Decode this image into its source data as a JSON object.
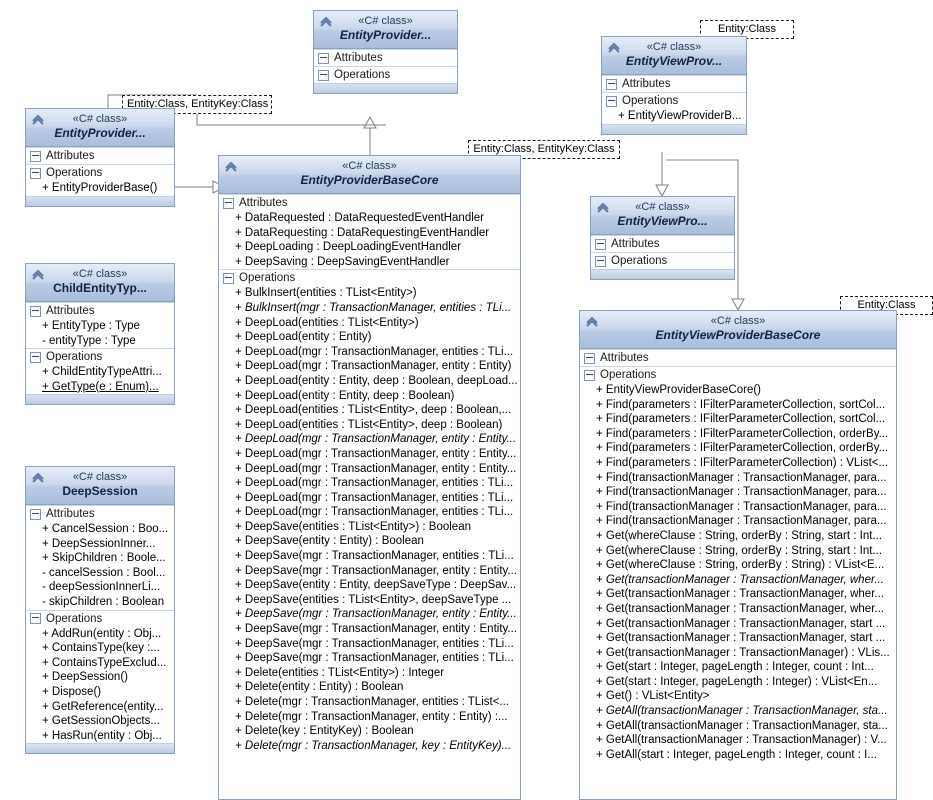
{
  "diagram": {
    "title": "UML Class Diagram",
    "stereotype": "«C# class»",
    "compartments": {
      "attributes": "Attributes",
      "operations": "Operations"
    },
    "icon": "double-chevron-icon"
  },
  "template_params": [
    {
      "id": "tp-entityprovider-base",
      "text": "Entity:Class, EntityKey:Class"
    },
    {
      "id": "tp-entityviewprov",
      "text": "Entity:Class"
    },
    {
      "id": "tp-entityproviderbasecore",
      "text": "Entity:Class, EntityKey:Class"
    },
    {
      "id": "tp-entityviewproviderbasecore",
      "text": "Entity:Class"
    }
  ],
  "classes": {
    "entity_provider_top": {
      "name": "EntityProvider...",
      "abstract": true,
      "attributes": [],
      "operations": []
    },
    "entity_provider_left": {
      "name": "EntityProvider...",
      "abstract": true,
      "attributes": [],
      "operations": [
        {
          "text": "+ EntityProviderBase()",
          "abstract": false,
          "static": false
        }
      ]
    },
    "child_entity_type": {
      "name": "ChildEntityTyp...",
      "abstract": false,
      "attributes": [
        {
          "text": "+ EntityType : Type",
          "abstract": false,
          "static": false
        },
        {
          "text": "- entityType : Type",
          "abstract": false,
          "static": false
        }
      ],
      "operations": [
        {
          "text": "+ ChildEntityTypeAttri...",
          "abstract": false,
          "static": false
        },
        {
          "text": "+ GetType(e : Enum)...",
          "abstract": false,
          "static": true
        }
      ]
    },
    "deep_session": {
      "name": "DeepSession",
      "abstract": false,
      "attributes": [
        {
          "text": "+ CancelSession : Boo...",
          "abstract": false,
          "static": false
        },
        {
          "text": "+ DeepSessionInner...",
          "abstract": false,
          "static": false
        },
        {
          "text": "+ SkipChildren : Boole...",
          "abstract": false,
          "static": false
        },
        {
          "text": "- cancelSession : Bool...",
          "abstract": false,
          "static": false
        },
        {
          "text": "- deepSessionInnerLi...",
          "abstract": false,
          "static": false
        },
        {
          "text": "- skipChildren : Boolean",
          "abstract": false,
          "static": false
        }
      ],
      "operations": [
        {
          "text": "+ AddRun(entity : Obj...",
          "abstract": false,
          "static": false
        },
        {
          "text": "+ ContainsType(key :...",
          "abstract": false,
          "static": false
        },
        {
          "text": "+ ContainsTypeExclud...",
          "abstract": false,
          "static": false
        },
        {
          "text": "+ DeepSession()",
          "abstract": false,
          "static": false
        },
        {
          "text": "+ Dispose()",
          "abstract": false,
          "static": false
        },
        {
          "text": "+ GetReference(entity...",
          "abstract": false,
          "static": false
        },
        {
          "text": "+ GetSessionObjects...",
          "abstract": false,
          "static": false
        },
        {
          "text": "+ HasRun(entity : Obj...",
          "abstract": false,
          "static": false
        }
      ]
    },
    "entity_provider_base_core": {
      "name": "EntityProviderBaseCore",
      "abstract": true,
      "attributes": [
        {
          "text": "+ DataRequested : DataRequestedEventHandler",
          "abstract": false,
          "static": false
        },
        {
          "text": "+ DataRequesting : DataRequestingEventHandler",
          "abstract": false,
          "static": false
        },
        {
          "text": "+ DeepLoading : DeepLoadingEventHandler",
          "abstract": false,
          "static": false
        },
        {
          "text": "+ DeepSaving : DeepSavingEventHandler",
          "abstract": false,
          "static": false
        }
      ],
      "operations": [
        {
          "text": "+ BulkInsert(entities : TList<Entity>)",
          "abstract": false,
          "static": false
        },
        {
          "text": "+ BulkInsert(mgr : TransactionManager, entities : TLi...",
          "abstract": true,
          "static": false
        },
        {
          "text": "+ DeepLoad(entities : TList<Entity>)",
          "abstract": false,
          "static": false
        },
        {
          "text": "+ DeepLoad(entity : Entity)",
          "abstract": false,
          "static": false
        },
        {
          "text": "+ DeepLoad(mgr : TransactionManager, entities : TLi...",
          "abstract": false,
          "static": false
        },
        {
          "text": "+ DeepLoad(mgr : TransactionManager, entity : Entity)",
          "abstract": false,
          "static": false
        },
        {
          "text": "+ DeepLoad(entity : Entity, deep : Boolean, deepLoad...",
          "abstract": false,
          "static": false
        },
        {
          "text": "+ DeepLoad(entity : Entity, deep : Boolean)",
          "abstract": false,
          "static": false
        },
        {
          "text": "+ DeepLoad(entities : TList<Entity>, deep : Boolean,...",
          "abstract": false,
          "static": false
        },
        {
          "text": "+ DeepLoad(entities : TList<Entity>, deep : Boolean)",
          "abstract": false,
          "static": false
        },
        {
          "text": "+ DeepLoad(mgr : TransactionManager, entity : Entity...",
          "abstract": true,
          "static": false
        },
        {
          "text": "+ DeepLoad(mgr : TransactionManager, entity : Entity...",
          "abstract": false,
          "static": false
        },
        {
          "text": "+ DeepLoad(mgr : TransactionManager, entity : Entity...",
          "abstract": false,
          "static": false
        },
        {
          "text": "+ DeepLoad(mgr : TransactionManager, entities : TLi...",
          "abstract": false,
          "static": false
        },
        {
          "text": "+ DeepLoad(mgr : TransactionManager, entities : TLi...",
          "abstract": false,
          "static": false
        },
        {
          "text": "+ DeepLoad(mgr : TransactionManager, entities : TLi...",
          "abstract": false,
          "static": false
        },
        {
          "text": "+ DeepSave(entities : TList<Entity>) : Boolean",
          "abstract": false,
          "static": false
        },
        {
          "text": "+ DeepSave(entity : Entity) : Boolean",
          "abstract": false,
          "static": false
        },
        {
          "text": "+ DeepSave(mgr : TransactionManager, entities : TLi...",
          "abstract": false,
          "static": false
        },
        {
          "text": "+ DeepSave(mgr : TransactionManager, entity : Entity...",
          "abstract": false,
          "static": false
        },
        {
          "text": "+ DeepSave(entity : Entity, deepSaveType : DeepSav...",
          "abstract": false,
          "static": false
        },
        {
          "text": "+ DeepSave(entities : TList<Entity>, deepSaveType ...",
          "abstract": false,
          "static": false
        },
        {
          "text": "+ DeepSave(mgr : TransactionManager, entity : Entity...",
          "abstract": true,
          "static": false
        },
        {
          "text": "+ DeepSave(mgr : TransactionManager, entity : Entity...",
          "abstract": false,
          "static": false
        },
        {
          "text": "+ DeepSave(mgr : TransactionManager, entities : TLi...",
          "abstract": false,
          "static": false
        },
        {
          "text": "+ DeepSave(mgr : TransactionManager, entities : TLi...",
          "abstract": false,
          "static": false
        },
        {
          "text": "+ Delete(entities : TList<Entity>) : Integer",
          "abstract": false,
          "static": false
        },
        {
          "text": "+ Delete(entity : Entity) : Boolean",
          "abstract": false,
          "static": false
        },
        {
          "text": "+ Delete(mgr : TransactionManager, entities : TList<...",
          "abstract": false,
          "static": false
        },
        {
          "text": "+ Delete(mgr : TransactionManager, entity : Entity) :...",
          "abstract": false,
          "static": false
        },
        {
          "text": "+ Delete(key : EntityKey) : Boolean",
          "abstract": false,
          "static": false
        },
        {
          "text": "+ Delete(mgr : TransactionManager, key : EntityKey)...",
          "abstract": true,
          "static": false
        }
      ]
    },
    "entity_view_prov_top": {
      "name": "EntityViewProv...",
      "abstract": true,
      "attributes": [],
      "operations": [
        {
          "text": "+ EntityViewProviderB...",
          "abstract": false,
          "static": false
        }
      ]
    },
    "entity_view_pro_mid": {
      "name": "EntityViewPro...",
      "abstract": true,
      "attributes": [],
      "operations": []
    },
    "entity_view_provider_base_core": {
      "name": "EntityViewProviderBaseCore",
      "abstract": true,
      "attributes": [],
      "operations": [
        {
          "text": "+ EntityViewProviderBaseCore()",
          "abstract": false,
          "static": false
        },
        {
          "text": "+ Find(parameters : IFilterParameterCollection, sortCol...",
          "abstract": false,
          "static": false
        },
        {
          "text": "+ Find(parameters : IFilterParameterCollection, sortCol...",
          "abstract": false,
          "static": false
        },
        {
          "text": "+ Find(parameters : IFilterParameterCollection, orderBy...",
          "abstract": false,
          "static": false
        },
        {
          "text": "+ Find(parameters : IFilterParameterCollection, orderBy...",
          "abstract": false,
          "static": false
        },
        {
          "text": "+ Find(parameters : IFilterParameterCollection) : VList<...",
          "abstract": false,
          "static": false
        },
        {
          "text": "+ Find(transactionManager : TransactionManager, para...",
          "abstract": false,
          "static": false
        },
        {
          "text": "+ Find(transactionManager : TransactionManager, para...",
          "abstract": false,
          "static": false
        },
        {
          "text": "+ Find(transactionManager : TransactionManager, para...",
          "abstract": false,
          "static": false
        },
        {
          "text": "+ Find(transactionManager : TransactionManager, para...",
          "abstract": false,
          "static": false
        },
        {
          "text": "+ Get(whereClause : String, orderBy : String, start : Int...",
          "abstract": false,
          "static": false
        },
        {
          "text": "+ Get(whereClause : String, orderBy : String, start : Int...",
          "abstract": false,
          "static": false
        },
        {
          "text": "+ Get(whereClause : String, orderBy : String) : VList<E...",
          "abstract": false,
          "static": false
        },
        {
          "text": "+ Get(transactionManager : TransactionManager, wher...",
          "abstract": true,
          "static": false
        },
        {
          "text": "+ Get(transactionManager : TransactionManager, wher...",
          "abstract": false,
          "static": false
        },
        {
          "text": "+ Get(transactionManager : TransactionManager, wher...",
          "abstract": false,
          "static": false
        },
        {
          "text": "+ Get(transactionManager : TransactionManager, start ...",
          "abstract": false,
          "static": false
        },
        {
          "text": "+ Get(transactionManager : TransactionManager, start ...",
          "abstract": false,
          "static": false
        },
        {
          "text": "+ Get(transactionManager : TransactionManager) : VLis...",
          "abstract": false,
          "static": false
        },
        {
          "text": "+ Get(start : Integer, pageLength : Integer, count : Int...",
          "abstract": false,
          "static": false
        },
        {
          "text": "+ Get(start : Integer, pageLength : Integer) : VList<En...",
          "abstract": false,
          "static": false
        },
        {
          "text": "+ Get() : VList<Entity>",
          "abstract": false,
          "static": false
        },
        {
          "text": "+ GetAll(transactionManager : TransactionManager, sta...",
          "abstract": true,
          "static": false
        },
        {
          "text": "+ GetAll(transactionManager : TransactionManager, sta...",
          "abstract": false,
          "static": false
        },
        {
          "text": "+ GetAll(transactionManager : TransactionManager) : V...",
          "abstract": false,
          "static": false
        },
        {
          "text": "+ GetAll(start : Integer, pageLength : Integer, count : I...",
          "abstract": false,
          "static": false
        }
      ]
    }
  },
  "colors": {
    "header_top": "#e6edf7",
    "header_bottom": "#a9bedd",
    "border": "#8ca2c4",
    "connector": "#808080",
    "text": "#000000"
  }
}
